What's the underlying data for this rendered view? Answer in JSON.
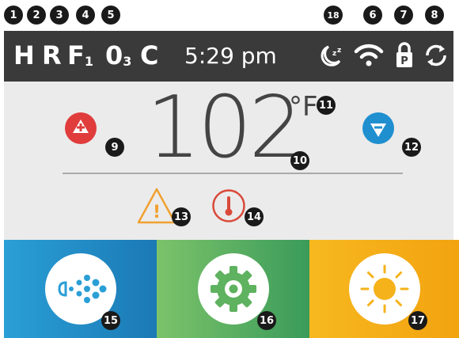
{
  "badges": [
    "1",
    "2",
    "3",
    "4",
    "5",
    "18",
    "6",
    "7",
    "8",
    "9",
    "10",
    "11",
    "12",
    "13",
    "14",
    "15",
    "16",
    "17"
  ],
  "status_bar": {
    "codes": [
      {
        "main": "H",
        "sub": ""
      },
      {
        "main": "R",
        "sub": ""
      },
      {
        "main": "F",
        "sub": "1"
      },
      {
        "main": "0",
        "sub": "3"
      },
      {
        "main": "C",
        "sub": ""
      }
    ],
    "time": "5:29 pm",
    "icons": [
      "sleep-icon",
      "wifi-icon",
      "panel-lock-icon",
      "sync-icon"
    ],
    "lock_letter": "P"
  },
  "temperature": {
    "value": "102",
    "unit": "°F"
  },
  "alerts": {
    "warning_symbol": "!"
  },
  "tiles": [
    {
      "name": "jets",
      "icon": "jets-icon"
    },
    {
      "name": "settings",
      "icon": "gear-icon"
    },
    {
      "name": "light",
      "icon": "sun-icon"
    }
  ],
  "colors": {
    "status_bar_bg": "#3a3a3a",
    "main_bg": "#ebebeb",
    "temp_up": "#e03c3c",
    "temp_down": "#1f8fd0",
    "warning": "#f0a030",
    "heater": "#d94a3a",
    "jets_tile": "#1b79b5",
    "settings_tile": "#3a9b5a",
    "light_tile": "#f2a310"
  }
}
